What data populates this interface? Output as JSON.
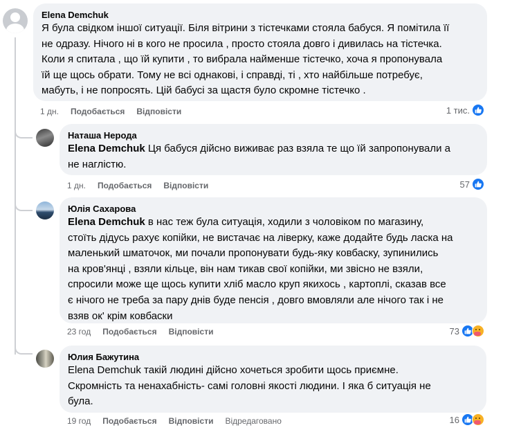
{
  "comments": [
    {
      "author": "Elena Demchuk",
      "text_lines": [
        "Я була свідком іншої ситуації. Біля вітрини з тістечками стояла бабуся. Я помітила її",
        "не одразу. Нічого ні в кого не просила , просто стояла довго і дивилась на тістечка.",
        "Коли я спитала , що їй купити , то вибрала найменше тістечко, хоча я пропонувала",
        "їй ще щось обрати. Тому не всі однакові, і справді, ті , хто найбільше потребує,",
        "мабуть, і не попросять. Цій бабусі за щастя було скромне тістечко ."
      ],
      "time": "1 дн.",
      "like_label": "Подобається",
      "reply_label": "Відповісти",
      "reaction_count": "1 тис."
    }
  ],
  "replies": [
    {
      "author": "Наташа Нерода",
      "mention": "Elena Demchuk",
      "first_line_rest": " Ця бабуся дійсно виживає раз взяла те що їй запропонували а",
      "text_lines": [
        "не наглістю."
      ],
      "time": "1 дн.",
      "like_label": "Подобається",
      "reply_label": "Відповісти",
      "reaction_count": "57"
    },
    {
      "author": "Юлія Сахарова",
      "mention": "Elena Demchuk",
      "first_line_rest": " в нас теж була ситуація, ходили з чоловіком по магазину,",
      "text_lines": [
        "стоїть дідусь рахує копійки, не вистачає на ліверку, каже додайте будь ласка на",
        "маленький шматочок, ми почали пропонувати будь-яку ковбаску, зупинились",
        "на кров'янці , взяли кільце, він нам тикав свої копійки, ми звісно не взяли,",
        "спросили може ще щось купити хліб масло круп якихось , картоплі, сказав все",
        "є нічого не треба за пару днів буде пенсія , довго вмовляли але нічого так і не",
        "взяв ок' крім ковбаски"
      ],
      "time": "23 год",
      "like_label": "Подобається",
      "reply_label": "Відповісти",
      "reaction_count": "73"
    },
    {
      "author": "Юлия Бажутина",
      "text_lines": [
        "Elena Demchuk такій людині дійсно хочеться зробити щось приємне.",
        "Скромність та ненахабність- самі головні якості людини. І яка б ситуація не",
        "була."
      ],
      "time": "19 год",
      "like_label": "Подобається",
      "reply_label": "Відповісти",
      "edited_label": "Відредаговано",
      "reaction_count": "16"
    }
  ],
  "reaction_icons": [
    "like-icon",
    "care-icon"
  ],
  "colors": {
    "bubble": "#f0f2f5",
    "meta_text": "#65676b",
    "like_blue": "#1877f2",
    "thread_line": "#ced0d4"
  }
}
